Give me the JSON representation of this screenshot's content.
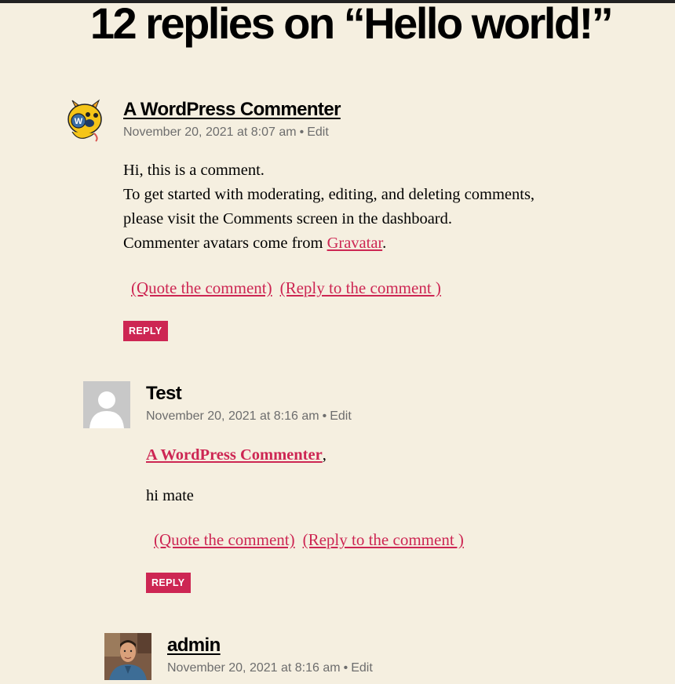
{
  "page": {
    "title": "12 replies on “Hello world!”",
    "edit_label": "Edit",
    "meta_separator": "•",
    "quote_label": "(Quote the comment)",
    "reply_to_label": "(Reply to the comment )",
    "reply_button": "REPLY"
  },
  "colors": {
    "accent": "#cd2653",
    "background": "#f5efe0",
    "meta": "#6d6d6d"
  },
  "comments": [
    {
      "author": "A WordPress Commenter",
      "date": "November 20, 2021 at 8:07 am",
      "avatar": "wapuu-avatar",
      "lines": [
        "Hi, this is a comment.",
        "To get started with moderating, editing, and deleting comments,",
        "please visit the Comments screen in the dashboard.",
        "Commenter avatars come from"
      ],
      "link_text": "Gravatar",
      "link_suffix": "."
    },
    {
      "author": "Test",
      "date": "November 20, 2021 at 8:16 am",
      "avatar": "default-user-avatar",
      "mention": "A WordPress Commenter",
      "mention_suffix": ",",
      "text": "hi mate"
    },
    {
      "author": "admin",
      "date": "November 20, 2021 at 8:16 am",
      "avatar": "admin-photo-avatar"
    }
  ]
}
